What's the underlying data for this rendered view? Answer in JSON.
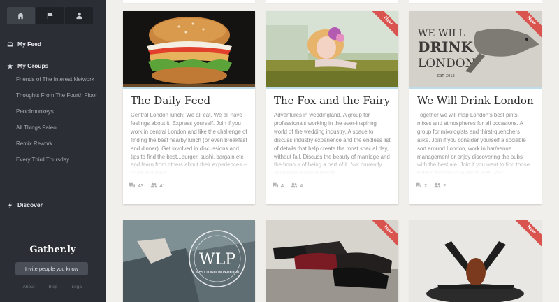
{
  "sidebar": {
    "nav_tabs": [
      "home-icon",
      "flag-icon",
      "user-icon"
    ],
    "my_feed": "My Feed",
    "my_groups": "My Groups",
    "groups": [
      "Friends of The Interest Network",
      "Thoughts From The Fourth Floor",
      "Pencilmonkeys",
      "All Things Paleo",
      "Remix Rework",
      "Every Third Thursday"
    ],
    "discover": "Discover",
    "brand": "Gather.ly",
    "invite": "Invite people you know",
    "footer": [
      "About",
      "Blog",
      "Legal"
    ]
  },
  "cards": [
    {
      "title": "The Daily Feed",
      "desc": "Central London lunch: We all eat. We all have feelings about it. Express yourself. Join if you work in central London and like the challenge of finding the best nearby lunch (or even breakfast and dinner). Get involved in discussions and tips to find the best...burger, sushi, bargain etc and learn from others about their experiences – good and bad!",
      "comments": "43",
      "members": "41",
      "badge": ""
    },
    {
      "title": "The Fox and the Fairy",
      "desc": "Adventures in weddingland. A group for professionals working in the ever-inspiring world of the wedding industry. A space to discuss industry experience and the endless list of details that help create the most special day, without fail. Discuss the beauty of marriage and the honour of being a part of it. Not currently accepting group requests.",
      "comments": "4",
      "members": "4",
      "badge": "New"
    },
    {
      "title": "We Will Drink London",
      "desc": "Together we will map London's best pints, mixes and atmospheres for all occasions. A group for mixologists and thirst-quenchers alike. Join if you consider yourself a sociable sort around London, work in bar/venue management or enjoy discovering the pubs with the best ale. Join if you want to find those hidden treasures to share with your",
      "comments": "2",
      "members": "2",
      "badge": "New"
    }
  ],
  "lower_cards": [
    {
      "badge": "",
      "image_text_1": "WLP",
      "image_text_2": "WEST LONDON PARKOUR"
    },
    {
      "badge": "New"
    },
    {
      "badge": "New"
    }
  ],
  "poster_text": [
    "WE WILL",
    "DRINK",
    "LONDON",
    "EST. 2013"
  ],
  "colors": {
    "sidebar": "#2b2f35",
    "accent_ribbon": "#d9534f",
    "card_border": "#bcdde9"
  }
}
